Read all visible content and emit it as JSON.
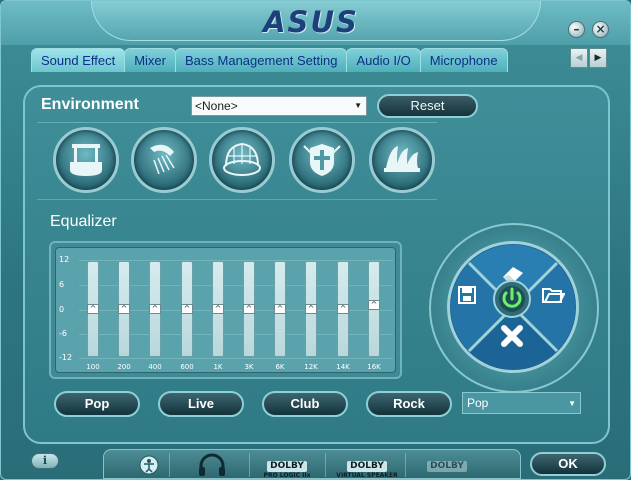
{
  "window": {
    "logo_text": "ASUS",
    "minimize_icon": "minimize-icon",
    "close_icon": "close-icon"
  },
  "tabs": [
    {
      "label": "Sound Effect",
      "active": true
    },
    {
      "label": "Mixer",
      "active": false
    },
    {
      "label": "Bass Management Setting",
      "active": false
    },
    {
      "label": "Audio I/O",
      "active": false
    },
    {
      "label": "Microphone",
      "active": false
    }
  ],
  "environment": {
    "label": "Environment",
    "selected": "<None>",
    "reset_label": "Reset",
    "presets": [
      "bathroom-icon",
      "shower-icon",
      "stadium-icon",
      "colosseum-icon",
      "opera-house-icon"
    ]
  },
  "equalizer": {
    "label": "Equalizer",
    "db_labels": [
      "12",
      "6",
      "0",
      "-6",
      "-12"
    ],
    "bands": [
      {
        "freq": "100",
        "value_db": 0
      },
      {
        "freq": "200",
        "value_db": 0
      },
      {
        "freq": "400",
        "value_db": 0
      },
      {
        "freq": "600",
        "value_db": 0
      },
      {
        "freq": "1K",
        "value_db": 0
      },
      {
        "freq": "3K",
        "value_db": 0
      },
      {
        "freq": "6K",
        "value_db": 0
      },
      {
        "freq": "12K",
        "value_db": 0
      },
      {
        "freq": "14K",
        "value_db": 0
      },
      {
        "freq": "16K",
        "value_db": 1
      }
    ]
  },
  "presets": {
    "buttons": [
      "Pop",
      "Live",
      "Club",
      "Rock"
    ],
    "selected": "Pop"
  },
  "wheel": {
    "top": "eraser-icon",
    "left": "save-icon",
    "right": "folder-icon",
    "bottom": "delete-icon",
    "center": "power-icon"
  },
  "bottom_bar": {
    "info_label": "i",
    "dolby_items": [
      {
        "logo": "DOLBY",
        "sub": "PRO LOGIC IIx"
      },
      {
        "logo": "DOLBY",
        "sub": "VIRTUAL SPEAKER"
      },
      {
        "logo": "DOLBY",
        "sub": ""
      }
    ],
    "ok_label": "OK"
  },
  "colors": {
    "accent": "#3e8f98",
    "tab_text": "#0e2f8a",
    "wheel_blue": "#1e5f8f"
  }
}
